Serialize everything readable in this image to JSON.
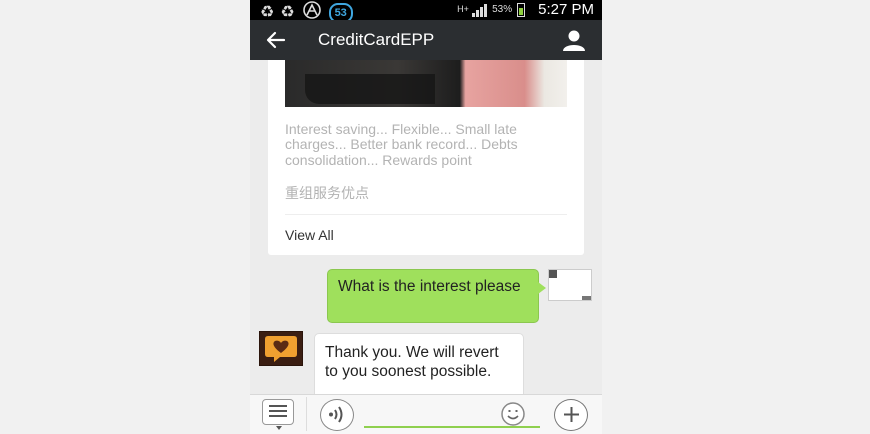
{
  "status_bar": {
    "notification_badge": "53",
    "network_type": "H+",
    "battery_percent": "53%",
    "time": "5:27 PM"
  },
  "title_bar": {
    "title": "CreditCardEPP"
  },
  "article_card": {
    "description": "Interest saving... Flexible... Small late charges... Better bank record... Debts consolidation... Rewards point",
    "chinese_text": "重组服务优点",
    "view_all_label": "View All"
  },
  "messages": [
    {
      "direction": "outgoing",
      "text": "What is the interest please"
    },
    {
      "direction": "incoming",
      "text": "Thank you. We will revert to you soonest possible."
    }
  ],
  "input_bar": {
    "text_value": ""
  },
  "colors": {
    "outgoing_bubble": "#9fe05c",
    "title_bar": "#2b2e31",
    "input_underline": "#8fd04f"
  },
  "icons": [
    "recycle-icon",
    "recycle-icon",
    "app-icon",
    "back-arrow-icon",
    "profile-icon",
    "menu-list-icon",
    "voice-icon",
    "emoji-icon",
    "plus-icon"
  ]
}
